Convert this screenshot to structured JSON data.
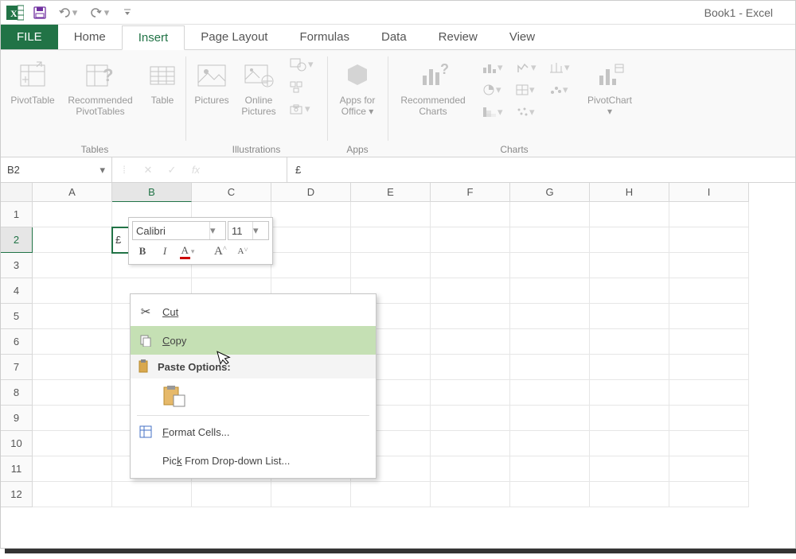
{
  "titlebar": {
    "document_title": "Book1 - Excel"
  },
  "tabs": {
    "file": "FILE",
    "home": "Home",
    "insert": "Insert",
    "page_layout": "Page Layout",
    "formulas": "Formulas",
    "data": "Data",
    "review": "Review",
    "view": "View"
  },
  "ribbon": {
    "tables": {
      "label": "Tables",
      "pivot_table": "PivotTable",
      "recommended_pivot": "Recommended\nPivotTables",
      "table": "Table"
    },
    "illustrations": {
      "label": "Illustrations",
      "pictures": "Pictures",
      "online_pictures": "Online\nPictures"
    },
    "apps": {
      "label": "Apps",
      "apps_for_office": "Apps for\nOffice"
    },
    "charts": {
      "label": "Charts",
      "recommended_charts": "Recommended\nCharts",
      "pivot_chart": "PivotChart"
    }
  },
  "name_box": {
    "value": "B2"
  },
  "formula_bar": {
    "value": "£"
  },
  "mini_toolbar": {
    "font_name": "Calibri",
    "font_size": "11"
  },
  "context_menu": {
    "cut": "Cut",
    "copy": "Copy",
    "paste_options": "Paste Options:",
    "format_cells": "Format Cells...",
    "pick_from_list": "Pick From Drop-down List..."
  },
  "columns": [
    "A",
    "B",
    "C",
    "D",
    "E",
    "F",
    "G",
    "H",
    "I"
  ],
  "rows": [
    "1",
    "2",
    "3",
    "4",
    "5",
    "6",
    "7",
    "8",
    "9",
    "10",
    "11",
    "12"
  ],
  "cells": {
    "B2": "£"
  }
}
